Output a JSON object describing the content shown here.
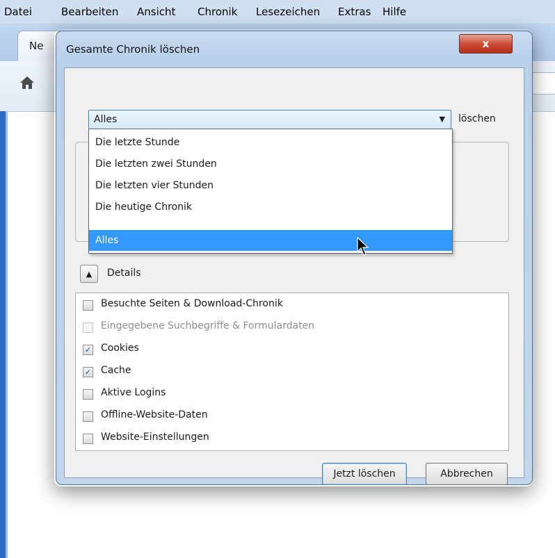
{
  "menu": [
    "Datei",
    "Bearbeiten",
    "Ansicht",
    "Chronik",
    "Lesezeichen",
    "Extras",
    "Hilfe"
  ],
  "browser": {
    "tab_label": "Ne"
  },
  "dialog": {
    "title": "Gesamte Chronik löschen",
    "close_label": "x",
    "range_select": {
      "value": "Alles",
      "suffix_label": "löschen",
      "options": [
        "Die letzte Stunde",
        "Die letzten zwei Stunden",
        "Die letzten vier Stunden",
        "Die heutige Chronik",
        "Alles"
      ],
      "selected_index": 4
    },
    "details_label": "Details",
    "items": [
      {
        "label": "Besuchte Seiten & Download-Chronik",
        "checked": false,
        "disabled": false
      },
      {
        "label": "Eingegebene Suchbegriffe & Formulardaten",
        "checked": false,
        "disabled": true
      },
      {
        "label": "Cookies",
        "checked": true,
        "disabled": false
      },
      {
        "label": "Cache",
        "checked": true,
        "disabled": false
      },
      {
        "label": "Aktive Logins",
        "checked": false,
        "disabled": false
      },
      {
        "label": "Offline-Website-Daten",
        "checked": false,
        "disabled": false
      },
      {
        "label": "Website-Einstellungen",
        "checked": false,
        "disabled": false
      }
    ],
    "buttons": {
      "clear_now": "Jetzt löschen",
      "cancel": "Abbrechen"
    }
  },
  "colors": {
    "selection": "#3399ff",
    "close_button": "#c9482f"
  }
}
